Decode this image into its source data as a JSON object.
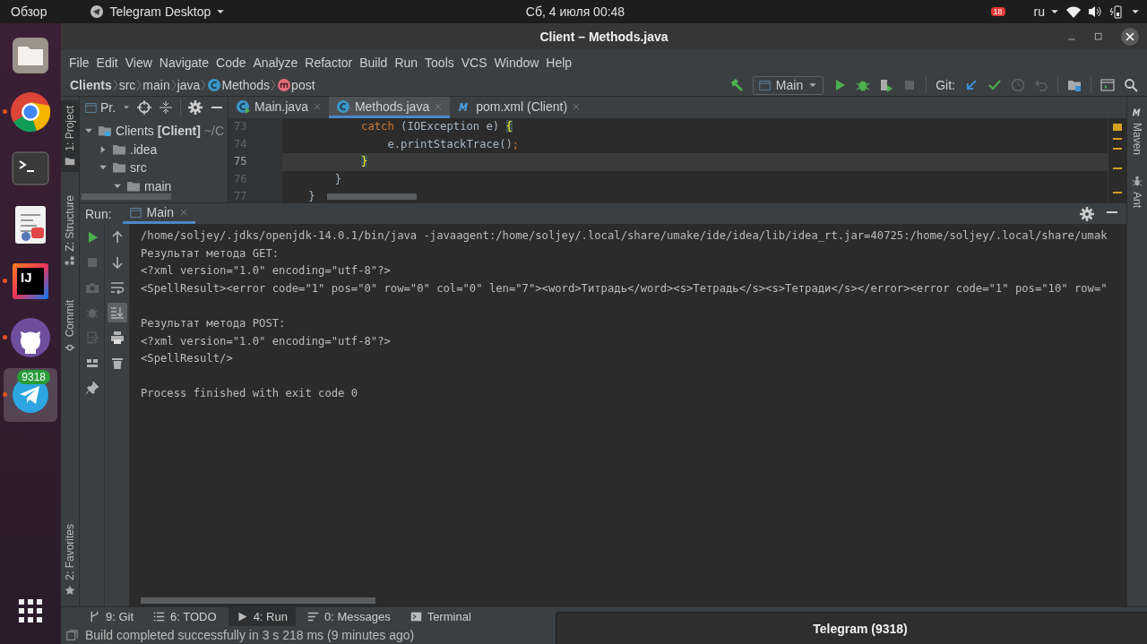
{
  "top_bar": {
    "activities": "Обзор",
    "app_menu": "Telegram Desktop",
    "clock": "Сб, 4 июля  00:48",
    "indicator_badge": "18",
    "language": "ru"
  },
  "dock": {
    "items": [
      {
        "kind": "files",
        "running": false,
        "selected": false
      },
      {
        "kind": "browser",
        "running": true,
        "selected": false
      },
      {
        "kind": "terminal",
        "running": false,
        "selected": false
      },
      {
        "kind": "document",
        "running": false,
        "selected": false
      },
      {
        "kind": "ide",
        "label": "IJ",
        "running": true,
        "selected": false
      },
      {
        "kind": "cat",
        "running": true,
        "selected": false
      },
      {
        "kind": "messenger",
        "running": true,
        "selected": true,
        "badge": "9318"
      }
    ]
  },
  "window": {
    "title": "Client – Methods.java"
  },
  "menu": [
    "File",
    "Edit",
    "View",
    "Navigate",
    "Code",
    "Analyze",
    "Refactor",
    "Build",
    "Run",
    "Tools",
    "VCS",
    "Window",
    "Help"
  ],
  "breadcrumbs": [
    {
      "kind": "project",
      "label": "Clients"
    },
    {
      "kind": "folder",
      "label": "src"
    },
    {
      "kind": "folder",
      "label": "main"
    },
    {
      "kind": "folder",
      "label": "java"
    },
    {
      "kind": "class",
      "label": "Methods"
    },
    {
      "kind": "method",
      "label": "post"
    }
  ],
  "toolbar": {
    "run_config": "Main",
    "vcs_label": "Git:"
  },
  "left_strip": [
    {
      "label": "1: Project",
      "kind": "project",
      "selected": true
    },
    {
      "label": "Z: Structure",
      "kind": "structure",
      "selected": false
    },
    {
      "label": "Commit",
      "kind": "commit",
      "selected": false
    }
  ],
  "left_strip_bottom": [
    {
      "label": "2: Favorites",
      "kind": "favorites",
      "selected": false
    }
  ],
  "right_strip": [
    {
      "label": "Maven",
      "kind": "maven"
    },
    {
      "label": "Ant",
      "kind": "ant"
    }
  ],
  "project_panel": {
    "title": "Pr.",
    "tree": [
      {
        "label": "Clients **[Client]**",
        "path": "~/C",
        "kind": "module",
        "expanded": true,
        "children": [
          {
            "label": ".idea",
            "kind": "folder",
            "expanded": false
          },
          {
            "label": "src",
            "kind": "folder",
            "expanded": true,
            "children": [
              {
                "label": "main",
                "kind": "folder",
                "expanded": true
              }
            ]
          }
        ]
      }
    ]
  },
  "editor": {
    "tabs": [
      {
        "label": "Main.java",
        "kind": "main-class",
        "selected": false
      },
      {
        "label": "Methods.java",
        "kind": "class",
        "selected": true
      },
      {
        "label": "pom.xml (Client)",
        "kind": "maven",
        "selected": false
      }
    ],
    "lines": [
      {
        "number": "73",
        "current": false,
        "tokens": [
          {
            "kind": "keyword",
            "text": "            catch"
          },
          {
            "kind": "plain",
            "text": " (IOException e) "
          },
          {
            "kind": "match",
            "text": "{"
          }
        ]
      },
      {
        "number": "74",
        "current": false,
        "tokens": [
          {
            "kind": "plain",
            "text": "                e.printStackTrace()"
          },
          {
            "kind": "keyword",
            "text": ";"
          }
        ]
      },
      {
        "number": "75",
        "current": true,
        "tokens": [
          {
            "kind": "match",
            "text": "            }"
          }
        ]
      },
      {
        "number": "76",
        "current": false,
        "tokens": [
          {
            "kind": "plain",
            "text": "        }"
          }
        ]
      },
      {
        "number": "77",
        "current": false,
        "tokens": [
          {
            "kind": "plain",
            "text": "    }"
          }
        ]
      }
    ]
  },
  "run_panel": {
    "label": "Run:",
    "tabs": [
      {
        "label": "Main",
        "selected": true
      }
    ],
    "run_actions": [
      {
        "kind": "rerun",
        "disabled": false
      },
      {
        "kind": "stop",
        "disabled": true
      },
      {
        "kind": "snapshot",
        "disabled": true
      },
      {
        "kind": "debug",
        "disabled": true
      },
      {
        "kind": "exit",
        "disabled": true
      },
      {
        "kind": "layout",
        "disabled": false
      },
      {
        "kind": "pin",
        "disabled": false
      }
    ],
    "console_actions": [
      {
        "kind": "up",
        "selected": false
      },
      {
        "kind": "down",
        "selected": false
      },
      {
        "kind": "wrap",
        "selected": false
      },
      {
        "kind": "scroll-end",
        "selected": true
      },
      {
        "kind": "print",
        "selected": false
      },
      {
        "kind": "trash",
        "selected": false
      }
    ],
    "console": [
      [
        "/home/soljey/.jdks/openjdk-14.0.1/bin/java -javaagent:/home/soljey/.local/share/umake/ide/idea/lib/idea_rt.jar=40725:/home/soljey/.local/share/umak",
        "Результат метода GET:",
        "<?xml version=\"1.0\" encoding=\"utf-8\"?>",
        "<SpellResult><error code=\"1\" pos=\"0\" row=\"0\" col=\"0\" len=\"7\"><word>Титрадь</word><s>Тетрадь</s><s>Тетради</s></error><error code=\"1\" pos=\"10\" row=\""
      ],
      [
        "Результат метода POST:",
        "<?xml version=\"1.0\" encoding=\"utf-8\"?>",
        "<SpellResult/>"
      ],
      [
        "Process finished with exit code 0"
      ]
    ]
  },
  "bottom_tabs": [
    {
      "label": "9: Git",
      "kind": "git",
      "selected": false
    },
    {
      "label": "6: TODO",
      "kind": "todo",
      "selected": false
    },
    {
      "label": "4: Run",
      "kind": "run",
      "selected": true
    },
    {
      "label": "0: Messages",
      "kind": "messages",
      "selected": false
    },
    {
      "label": "Terminal",
      "kind": "terminal",
      "selected": false
    }
  ],
  "status_bar": {
    "message": "Build completed successfully in 3 s 218 ms (9 minutes ago)"
  },
  "notification": {
    "title": "Telegram (9318)"
  }
}
